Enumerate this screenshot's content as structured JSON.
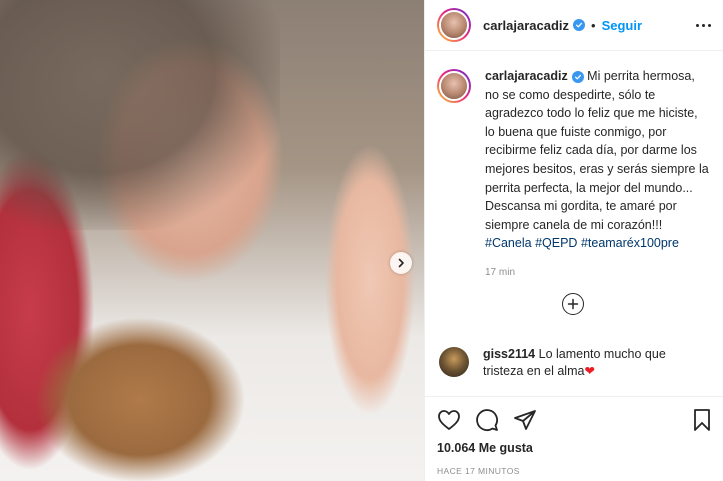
{
  "post": {
    "username": "carlajaracadiz",
    "separator": "•",
    "follow_label": "Seguir"
  },
  "caption": {
    "username": "carlajaracadiz",
    "text": " Mi perrita hermosa, no se como despedirte, sólo te agradezco todo lo feliz que me hiciste, lo buena que fuiste conmigo, por recibirme feliz cada día, por darme los mejores besitos, eras y serás siempre la perrita perfecta, la mejor del mundo... Descansa mi gordita, te amaré por siempre canela de mi corazón!!! ",
    "hashtags": [
      "#Canela",
      "#QEPD",
      "#teamaréx100pre"
    ],
    "time": "17 min"
  },
  "comments": [
    {
      "username": "giss2114",
      "text": " Lo lamento mucho que tristeza en el alma",
      "emoji": "❤"
    }
  ],
  "stats": {
    "likes": "10.064 Me gusta",
    "posted_ago": "HACE 17 MINUTOS"
  },
  "icons": {
    "photo_next": "chevron-right-icon",
    "verified": "verified-badge-icon",
    "more": "more-options-icon",
    "load_comments": "plus-circle-icon",
    "like": "heart-icon",
    "comment": "comment-bubble-icon",
    "share": "paper-plane-icon",
    "save": "bookmark-icon"
  },
  "colors": {
    "accent": "#0095f6",
    "verified": "#3897f0",
    "hashtag": "#00376b",
    "muted": "#8e8e8e",
    "heart": "#ed1c24"
  }
}
